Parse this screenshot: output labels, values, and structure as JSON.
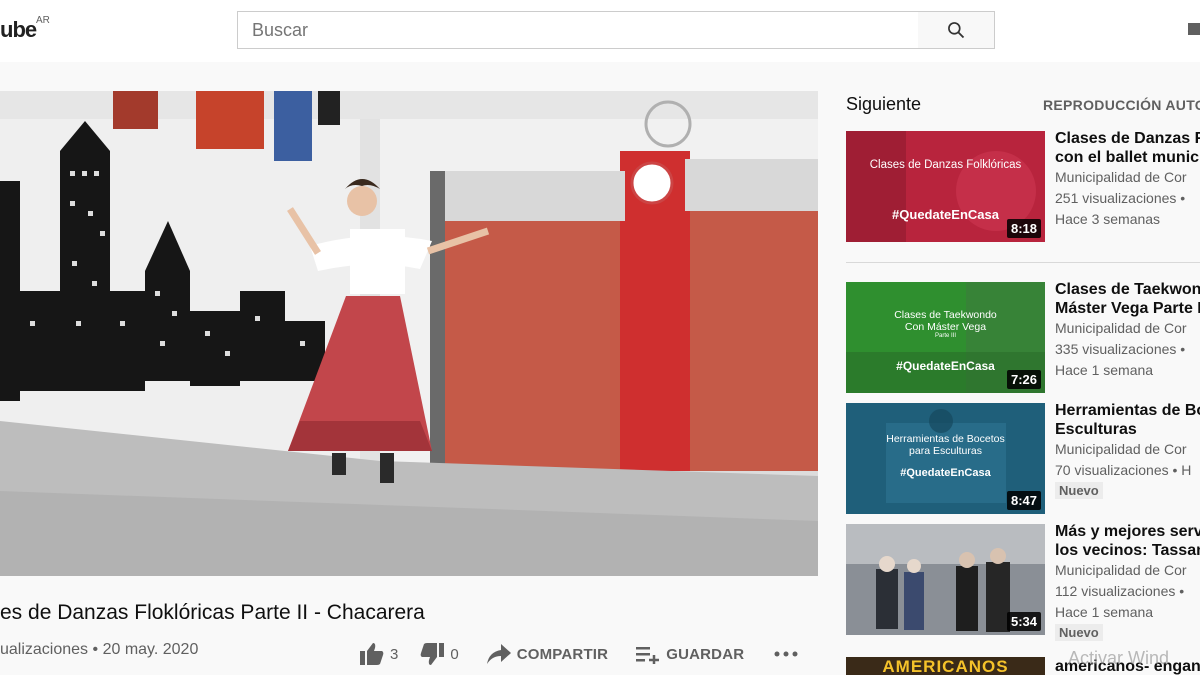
{
  "header": {
    "logo_text": "ube",
    "country": "AR",
    "search_placeholder": "Buscar"
  },
  "video": {
    "title": "es de Danzas Floklóricas Parte II - Chacarera",
    "views": "ualizaciones",
    "separator": "•",
    "date": "20 may. 2020",
    "likes": "3",
    "dislikes": "0",
    "share_label": "COMPARTIR",
    "save_label": "GUARDAR"
  },
  "sidebar": {
    "up_next_label": "Siguiente",
    "autoplay_label": "REPRODUCCIÓN AUTO",
    "items": [
      {
        "title": "Clases de Danzas F\ncon el ballet munici",
        "channel": "Municipalidad de Cor",
        "views": "251 visualizaciones •",
        "age": "Hace 3 semanas",
        "duration": "8:18",
        "thumb_line1": "Clases de Danzas Folklóricas",
        "thumb_tag": "#QuedateEnCasa",
        "badge": ""
      },
      {
        "title": "Clases de Taekwond\nMáster Vega Parte I",
        "channel": "Municipalidad de Cor",
        "views": "335 visualizaciones •",
        "age": "Hace 1 semana",
        "duration": "7:26",
        "thumb_line1": "Clases de Taekwondo",
        "thumb_line2": "Con Máster Vega",
        "thumb_line3": "Parte III",
        "thumb_tag": "#QuedateEnCasa",
        "badge": ""
      },
      {
        "title": "Herramientas de Bo\nEsculturas",
        "channel": "Municipalidad de Cor",
        "views": "70 visualizaciones • H",
        "age": "",
        "duration": "8:47",
        "thumb_line1": "Herramientas de Bocetos",
        "thumb_line2": "para Esculturas",
        "thumb_tag": "#QuedateEnCasa",
        "badge": "Nuevo"
      },
      {
        "title": "Más y mejores serv\nlos vecinos: Tassan",
        "channel": "Municipalidad de Cor",
        "views": "112 visualizaciones •",
        "age": "Hace 1 semana",
        "duration": "5:34",
        "badge": "Nuevo"
      },
      {
        "title": "americanos- enganc",
        "thumb_text": "AMERICANOS"
      }
    ]
  },
  "watermark": "Activar Wind",
  "colors": {
    "accent_red": "#cc0000",
    "thumb1_bg": "#b8243d",
    "thumb2_bg": "#2f8f2f",
    "thumb3_bg": "#1f5f7a"
  }
}
